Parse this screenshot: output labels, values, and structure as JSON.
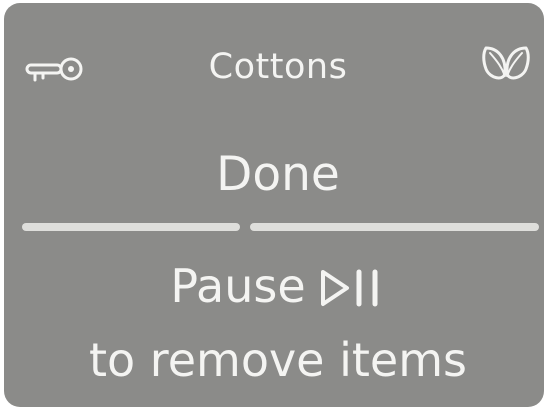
{
  "screen": {
    "program_label": "Cottons",
    "status_label": "Done",
    "pause_label": "Pause",
    "instruction_label": "to remove items",
    "progress_segments": [
      {
        "name": "first",
        "filled": true
      },
      {
        "name": "second",
        "filled": true
      }
    ],
    "icons": {
      "left": "key-icon",
      "right": "eco-leaf-icon",
      "pause": "play-pause-icon"
    },
    "colors": {
      "panel_background": "#8b8b89",
      "foreground": "#f4f4f2",
      "progress": "#dededb"
    }
  }
}
